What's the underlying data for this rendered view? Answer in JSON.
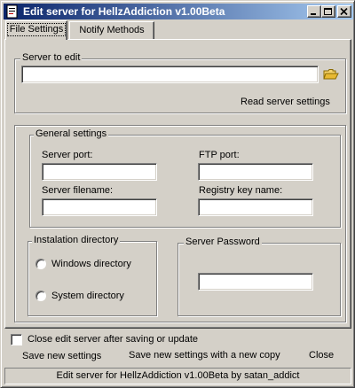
{
  "window": {
    "title": "Edit server for HellzAddiction v1.00Beta"
  },
  "tabs": [
    {
      "label": "File Settings",
      "active": true
    },
    {
      "label": "Notify Methods",
      "active": false
    }
  ],
  "server_to_edit": {
    "group_label": "Server to edit",
    "path_value": "",
    "read_settings_label": "Read server settings"
  },
  "general_settings": {
    "group_label": "General settings",
    "server_port_label": "Server port:",
    "server_port_value": "",
    "ftp_port_label": "FTP port:",
    "ftp_port_value": "",
    "server_filename_label": "Server filename:",
    "server_filename_value": "",
    "registry_key_label": "Registry key name:",
    "registry_key_value": ""
  },
  "install_dir": {
    "group_label": "Instalation directory",
    "options": [
      "Windows directory",
      "System directory"
    ],
    "selected": null
  },
  "server_password": {
    "group_label": "Server Password",
    "value": ""
  },
  "close_after_save": {
    "label": "Close edit server after saving or update",
    "checked": false
  },
  "actions": {
    "save_new": "Save new settings",
    "save_copy": "Save new settings with a new copy",
    "close": "Close"
  },
  "status": {
    "text": "Edit server for HellzAddiction v1.00Beta by satan_addict"
  },
  "colors": {
    "face": "#d4d0c8",
    "title_start": "#0a246a",
    "title_end": "#a6caf0"
  }
}
